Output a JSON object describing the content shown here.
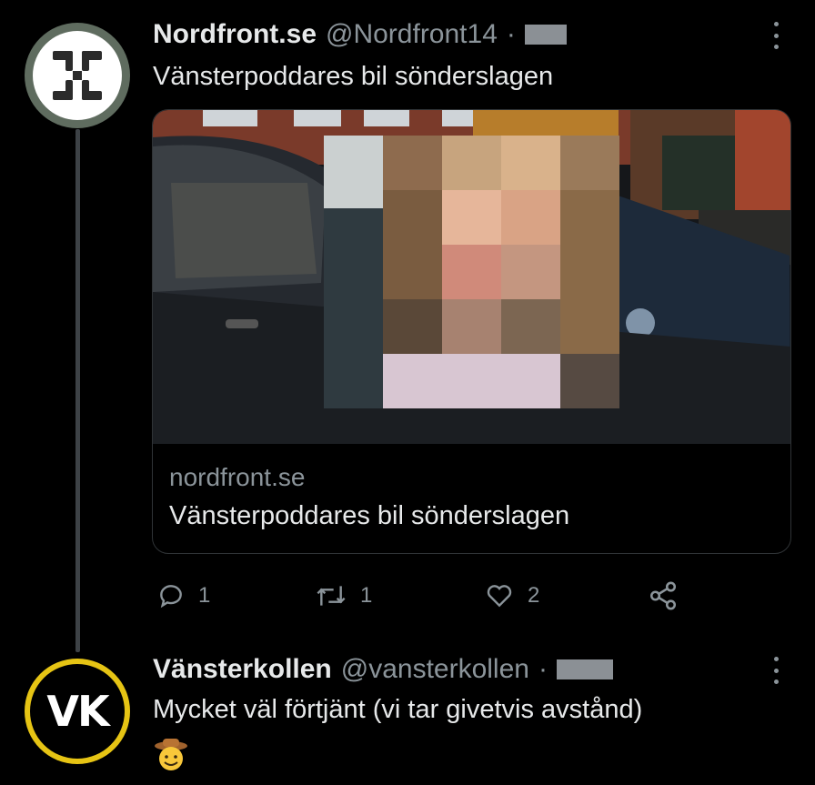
{
  "tweet1": {
    "display_name": "Nordfront.se",
    "handle": "@Nordfront14",
    "separator": "·",
    "text": "Vänsterpoddares bil sönderslagen",
    "card": {
      "domain": "nordfront.se",
      "title": "Vänsterpoddares bil sönderslagen",
      "image": "photo of damaged car with pixelated face overlay"
    },
    "actions": {
      "reply_icon": "speech-bubble-icon",
      "reply_count": "1",
      "retweet_icon": "retweet-arrows-icon",
      "retweet_count": "1",
      "like_icon": "heart-icon",
      "like_count": "2",
      "share_icon": "share-nodes-icon"
    }
  },
  "tweet2": {
    "display_name": "Vänsterkollen",
    "handle": "@vansterkollen",
    "separator": "·",
    "text": "Mycket väl förtjänt (vi tar givetvis avstånd)",
    "emoji": "cowboy-face",
    "avatar_text": "VK"
  },
  "colors": {
    "background": "#000000",
    "text": "#e7e9ea",
    "muted": "#8b949a",
    "border": "#2f3336",
    "vk_ring": "#e6c414",
    "nf_ring": "#5f6c5f"
  }
}
